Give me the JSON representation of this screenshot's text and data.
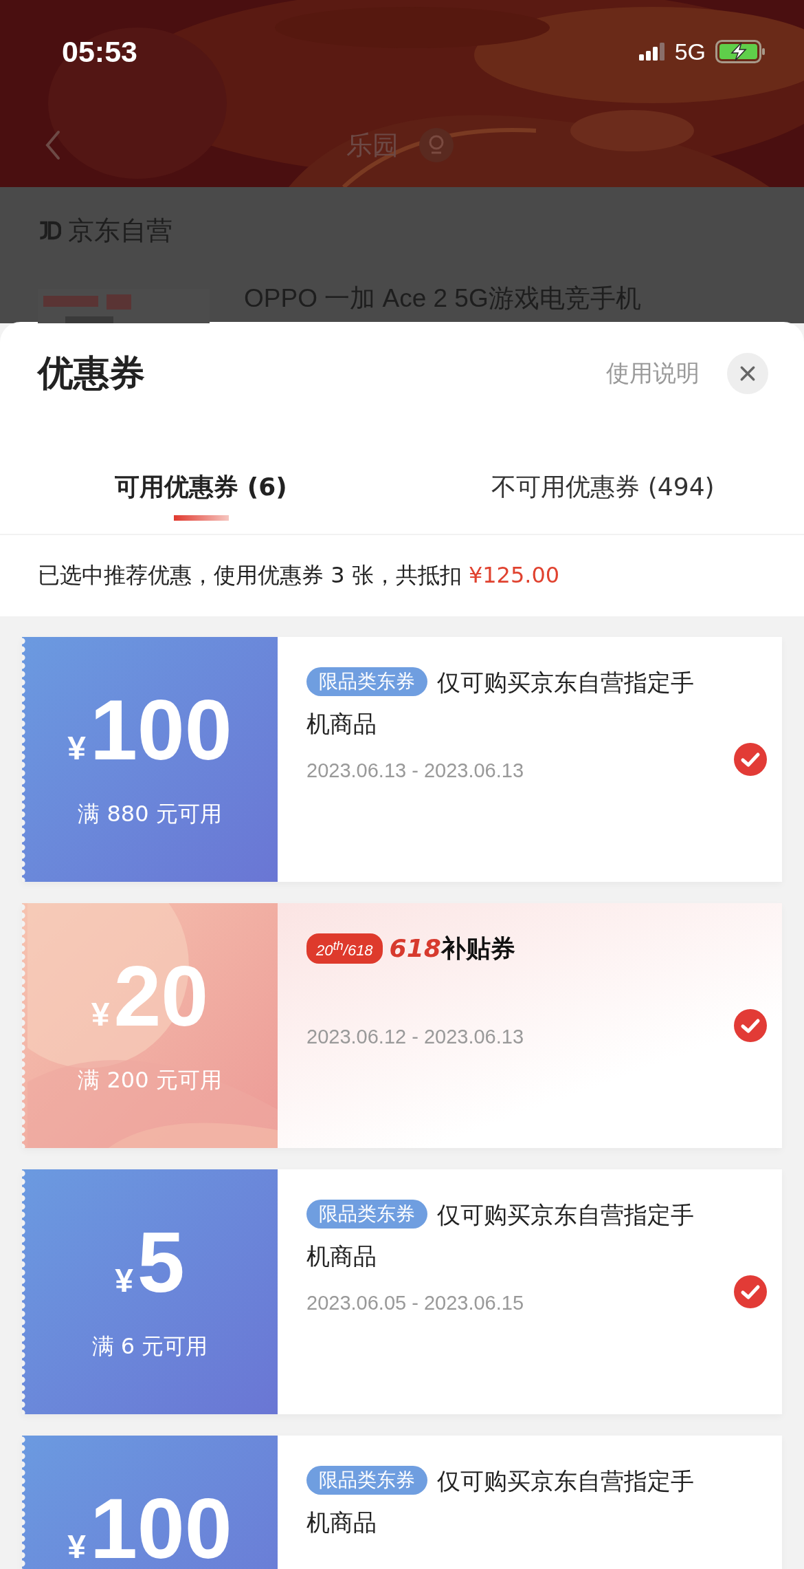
{
  "status_bar": {
    "time": "05:53",
    "network": "5G"
  },
  "nav": {
    "title": "乐园"
  },
  "store": {
    "name": "京东自营"
  },
  "product": {
    "title": "OPPO 一加 Ace 2 5G游戏电竞手机"
  },
  "sheet": {
    "title": "优惠券",
    "help_link": "使用说明"
  },
  "tabs": [
    {
      "label": "可用优惠券 (6)",
      "selected": true
    },
    {
      "label": "不可用优惠券 (494)",
      "selected": false
    }
  ],
  "summary": {
    "text": "已选中推荐优惠，使用优惠券 3 张，共抵扣 ",
    "amount": "¥125.00"
  },
  "coupons": [
    {
      "kind": "jd",
      "currency": "¥",
      "amount": "100",
      "condition": "满 880 元可用",
      "tag": "限品类东券",
      "description": "仅可购买京东自营指定手机商品",
      "dates": "2023.06.13 - 2023.06.13",
      "checked": true
    },
    {
      "kind": "subsidy",
      "currency": "¥",
      "amount": "20",
      "condition": "满 200 元可用",
      "badge": "20$^{th}$/618",
      "brand": "618",
      "title": "补贴券",
      "dates": "2023.06.12 - 2023.06.13",
      "checked": true
    },
    {
      "kind": "jd",
      "currency": "¥",
      "amount": "5",
      "condition": "满 6 元可用",
      "tag": "限品类东券",
      "description": "仅可购买京东自营指定手机商品",
      "dates": "2023.06.05 - 2023.06.15",
      "checked": true
    },
    {
      "kind": "jd",
      "currency": "¥",
      "amount": "100",
      "tag": "限品类东券",
      "description": "仅可购买京东自营指定手机商品"
    }
  ]
}
